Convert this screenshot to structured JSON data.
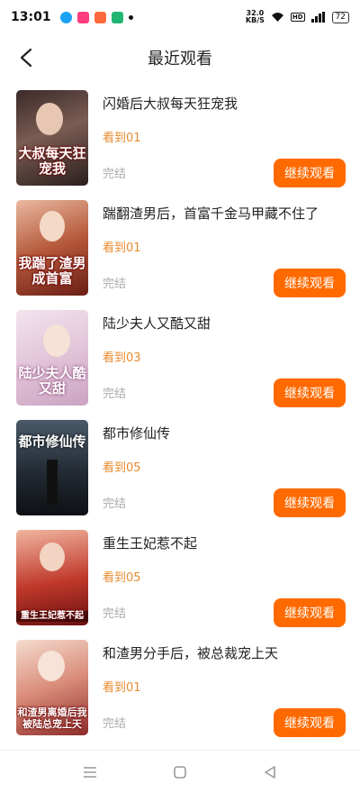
{
  "status_bar": {
    "time": "13:01",
    "net_speed_value": "32.0",
    "net_speed_unit": "KB/S",
    "hd_label": "HD",
    "signal_label": "4G",
    "battery": "72",
    "app_icon_colors": [
      "#1aa3f5",
      "#ff3d7f",
      "#ff6a3d",
      "#22b573"
    ]
  },
  "header": {
    "title": "最近观看",
    "back_icon": "chevron-left-icon"
  },
  "accent_color": "#ff6a00",
  "progress_color": "#e88a2e",
  "continue_label": "继续观看",
  "books": [
    {
      "title": "闪婚后大叔每天狂宠我",
      "progress": "看到01",
      "status": "完结",
      "cover_text": "大叔每天狂宠我"
    },
    {
      "title": "踹翻渣男后，首富千金马甲藏不住了",
      "progress": "看到01",
      "status": "完结",
      "cover_text": "我踹了渣男成首富"
    },
    {
      "title": "陆少夫人又酷又甜",
      "progress": "看到03",
      "status": "完结",
      "cover_text": "陆少夫人酷又甜"
    },
    {
      "title": "都市修仙传",
      "progress": "看到05",
      "status": "完结",
      "cover_text": "都市修仙传"
    },
    {
      "title": "重生王妃惹不起",
      "progress": "看到05",
      "status": "完结",
      "cover_text": "重生王妃惹不起"
    },
    {
      "title": "和渣男分手后，被总裁宠上天",
      "progress": "看到01",
      "status": "完结",
      "cover_text": "和渣男离婚后我被陆总宠上天"
    }
  ],
  "nav": [
    "menu-icon",
    "home-square-icon",
    "back-triangle-icon"
  ]
}
